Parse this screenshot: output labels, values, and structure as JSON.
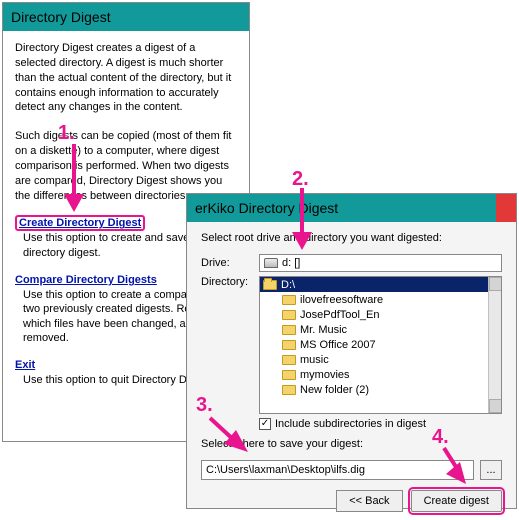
{
  "win1": {
    "title": "Directory Digest",
    "intro": "Directory Digest creates a digest of a selected directory. A digest is much shorter than the actual content of the directory, but it contains enough information to accurately detect any changes in the content.",
    "intro2": "Such digests can be copied (most of them fit on a diskette) to a computer, where digest comparison is performed. When two digests are compared, Directory Digest shows you the differences between directories.",
    "create_link": "Create Directory Digest",
    "create_desc": "Use this option to create and save a directory digest.",
    "compare_link": "Compare Directory Digests",
    "compare_desc": "Use this option to create a comparison of two previously created digests. Reports which files have been changed, added or removed.",
    "exit_link": "Exit",
    "exit_desc": "Use this option to quit Directory Digest."
  },
  "win2": {
    "title": "erKiko Directory Digest",
    "prompt": "Select root drive and directory you want digested:",
    "drive_label": "Drive:",
    "drive_value": "d: []",
    "dir_label": "Directory:",
    "root": "D:\\",
    "folders": [
      "ilovefreesoftware",
      "JosePdfTool_En",
      "Mr. Music",
      "MS Office 2007",
      "music",
      "mymovies",
      "New folder (2)"
    ],
    "include_label": "Include subdirectories in digest",
    "save_prompt": "Select where to save your digest:",
    "save_path": "C:\\Users\\laxman\\Desktop\\ilfs.dig",
    "browse": "...",
    "back_btn": "<< Back",
    "create_btn": "Create digest"
  },
  "ann": {
    "n1": "1.",
    "n2": "2.",
    "n3": "3.",
    "n4": "4."
  }
}
